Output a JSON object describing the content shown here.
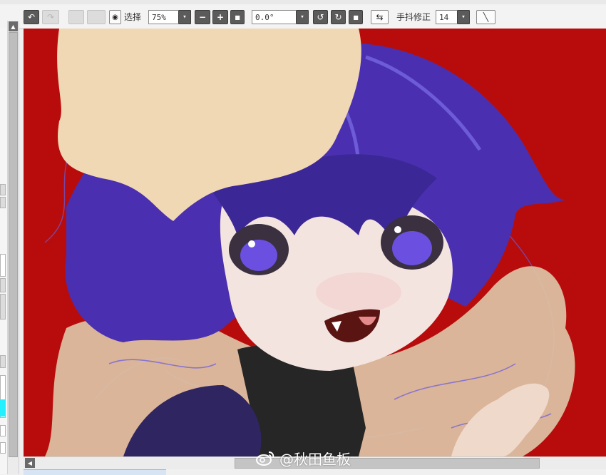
{
  "toolbar": {
    "select_label": "选择",
    "zoom_value": "75%",
    "rotation_value": "0.0°",
    "stabilizer_label": "手抖修正",
    "stabilizer_value": "14"
  },
  "icons": {
    "undo": "↶",
    "redo": "↷",
    "eye": "◉",
    "zoom_out": "−",
    "zoom_in": "+",
    "reset": "■",
    "rotate_left": "↺",
    "rotate_right": "↻",
    "rotate_reset": "■",
    "flip": "⇆",
    "pen": "╲",
    "dropdown": "▾",
    "scroll_up": "▲",
    "scroll_left": "◀"
  },
  "canvas": {
    "background_color": "#b80c0c"
  },
  "watermark": {
    "text": "@秋田鱼板"
  }
}
